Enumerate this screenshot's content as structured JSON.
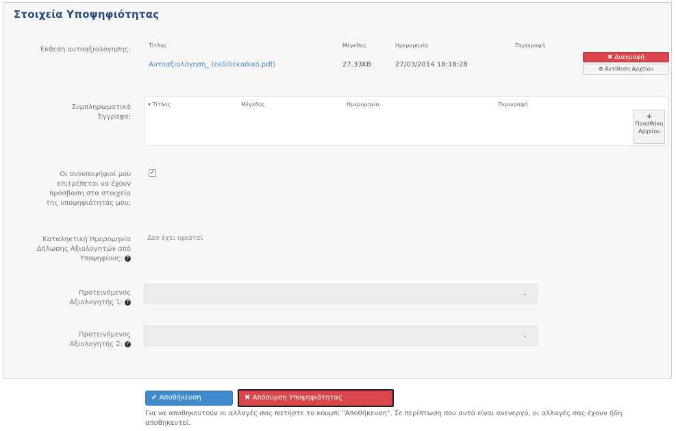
{
  "page": {
    "title": "Στοιχεία Υποψηφιότητας"
  },
  "report": {
    "label": "Έκθεση αυτοαξιολόγησης:",
    "headers": {
      "title": "Τίτλος",
      "size": "Μέγεθος",
      "date": "Ημερομηνία",
      "actions": "Περιγραφή"
    },
    "file": {
      "name": "Αυτοαξιολόγηση_ (εκδίδεκαδικό.pdf)",
      "size": "27.33KB",
      "date": "27/03/2014 18:18:28"
    },
    "delete_label": "Διαγραφή",
    "replace_label": "Αντίθεση Αρχείου"
  },
  "supporting": {
    "label_line1": "Συμπληρωματικά",
    "label_line2": "Έγγραφα:",
    "headers": {
      "title": "Τίτλος",
      "size": "Μέγεθος",
      "date": "Ημερομηνία",
      "actions": "Περιγραφή"
    },
    "add_line1": "Προσθήκη",
    "add_line2": "Αρχείου"
  },
  "access": {
    "label_line1": "Οι συνυποψήφιοί μου",
    "label_line2": "επιτρέπεται να έχουν",
    "label_line3": "πρόσβαση στα στοιχεία",
    "label_line4": "της υποψηφιότητάς μου:",
    "checked_mark": "✓"
  },
  "deadline": {
    "label_line1": "Καταληκτική Ημερομηνία",
    "label_line2": "Δήλωσης Αξιολογητών από",
    "label_line3": "Υποψηφίους:",
    "value": "Δεν έχει οριστεί"
  },
  "evaluator1": {
    "label_line1": "Προτεινόμενος",
    "label_line2": "Αξιολογητής 1:"
  },
  "evaluator2": {
    "label_line1": "Προτεινόμενος",
    "label_line2": "Αξιολογητής 2:"
  },
  "footer": {
    "save_label": "Αποθήκευση",
    "withdraw_label": "Απόσυρση Υποψηφιότητας",
    "note": "Για να αποθηκευτούν οι αλλαγές σας πατήστε το κουμπί \"Αποθήκευση\". Σε περίπτωση που αυτό είναι ανενεργό, οι αλλαγές σας έχουν ήδη αποθηκευτεί."
  },
  "icons": {
    "check": "✔",
    "delete": "✖",
    "replace": "⊕",
    "add": "+",
    "chevron": "⌄",
    "help": "?"
  },
  "colors": {
    "title": "#2a4d7a",
    "link": "#4a86c5",
    "danger": "#d9474c",
    "primary": "#428bca"
  }
}
